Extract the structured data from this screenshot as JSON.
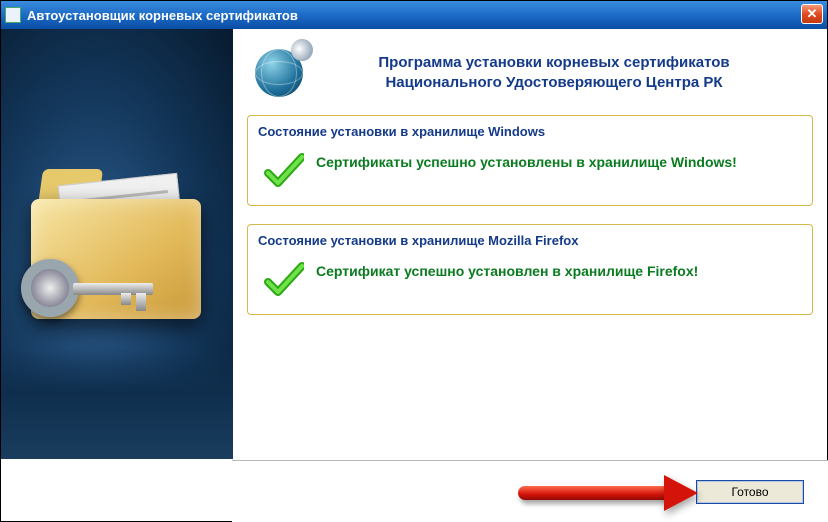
{
  "window": {
    "title": "Автоустановщик корневых сертификатов"
  },
  "header": {
    "line1": "Программа установки корневых сертификатов",
    "line2": "Национального Удостоверяющего Центра РК"
  },
  "panels": {
    "windows": {
      "title": "Состояние установки в хранилище Windows",
      "message": "Сертификаты успешно установлены в хранилище Windows!"
    },
    "firefox": {
      "title": "Состояние установки в хранилище Mozilla Firefox",
      "message": "Сертификат успешно установлен в хранилище Firefox!"
    }
  },
  "footer": {
    "done_label": "Готово"
  }
}
